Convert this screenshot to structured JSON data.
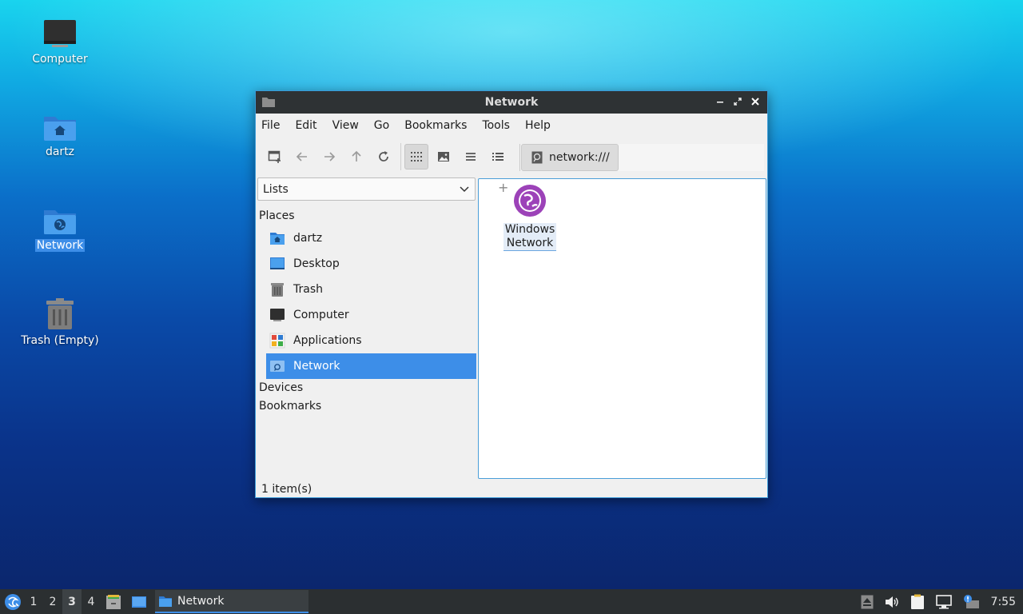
{
  "desktop": {
    "icons": [
      {
        "label": "Computer"
      },
      {
        "label": "dartz"
      },
      {
        "label": "Network"
      },
      {
        "label": "Trash (Empty)"
      }
    ]
  },
  "window": {
    "title": "Network",
    "menu": [
      "File",
      "Edit",
      "View",
      "Go",
      "Bookmarks",
      "Tools",
      "Help"
    ],
    "location": "network:///",
    "sidepane": {
      "combo_value": "Lists",
      "places_header": "Places",
      "places": [
        "dartz",
        "Desktop",
        "Trash",
        "Computer",
        "Applications",
        "Network"
      ],
      "devices_header": "Devices",
      "bookmarks_header": "Bookmarks"
    },
    "items": [
      {
        "line1": "Windows",
        "line2": "Network"
      }
    ],
    "status": "1 item(s)"
  },
  "taskbar": {
    "workspaces": [
      "1",
      "2",
      "3",
      "4"
    ],
    "active_workspace": "3",
    "task_label": "Network",
    "clock": "7:55"
  },
  "colors": {
    "accent": "#3d8ee8",
    "titlebar": "#2e3234",
    "panel": "#2b2f31"
  }
}
